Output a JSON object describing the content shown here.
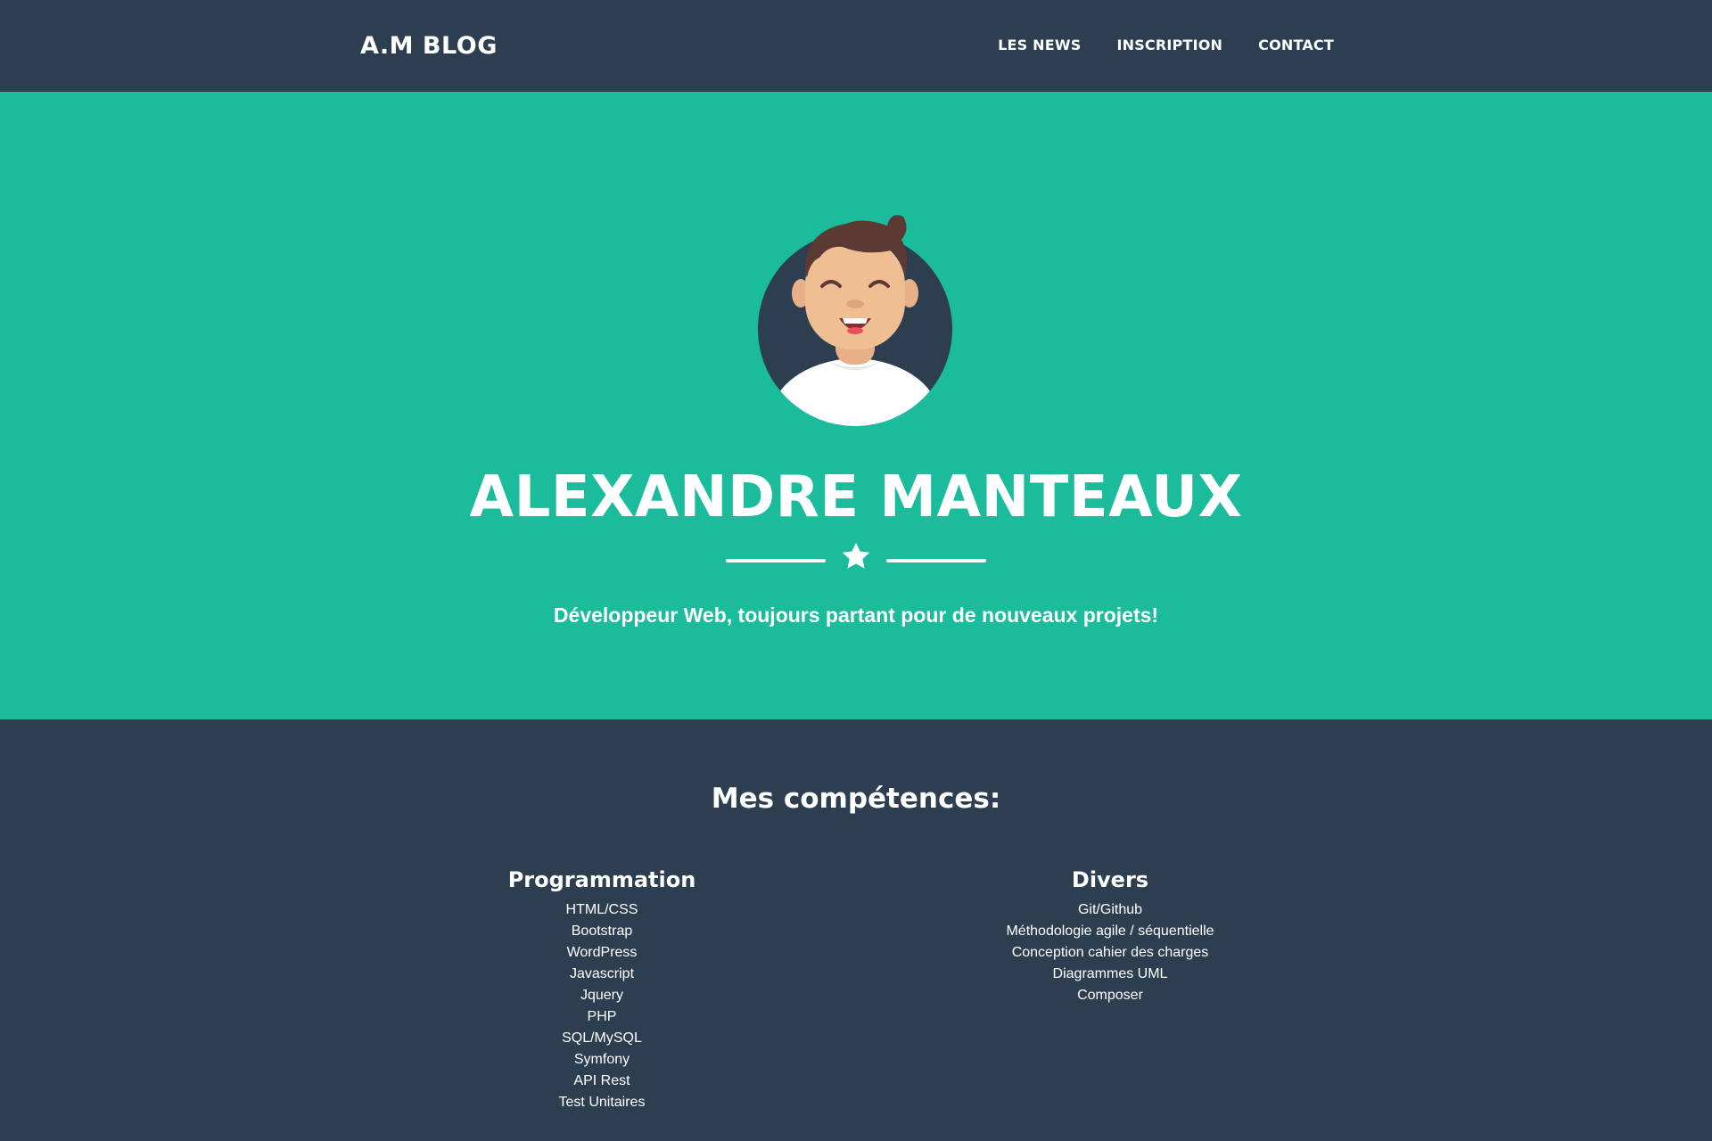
{
  "navbar": {
    "brand": "A.M BLOG",
    "links": [
      "LES NEWS",
      "INSCRIPTION",
      "CONTACT"
    ]
  },
  "masthead": {
    "name": "ALEXANDRE MANTEAUX",
    "subtitle": "Développeur Web, toujours partant pour de nouveaux projets!",
    "avatar_icon": "avatar-illustration",
    "divider_icon": "star-icon"
  },
  "skills": {
    "title": "Mes compétences:",
    "columns": [
      {
        "heading": "Programmation",
        "items": [
          "HTML/CSS",
          "Bootstrap",
          "WordPress",
          "Javascript",
          "Jquery",
          "PHP",
          "SQL/MySQL",
          "Symfony",
          "API Rest",
          "Test Unitaires"
        ]
      },
      {
        "heading": "Divers",
        "items": [
          "Git/Github",
          "Méthodologie agile / séquentielle",
          "Conception cahier des charges",
          "Diagrammes UML",
          "Composer"
        ]
      }
    ]
  },
  "colors": {
    "dark": "#2c3e50",
    "accent": "#1abc9c",
    "text": "#ffffff"
  }
}
